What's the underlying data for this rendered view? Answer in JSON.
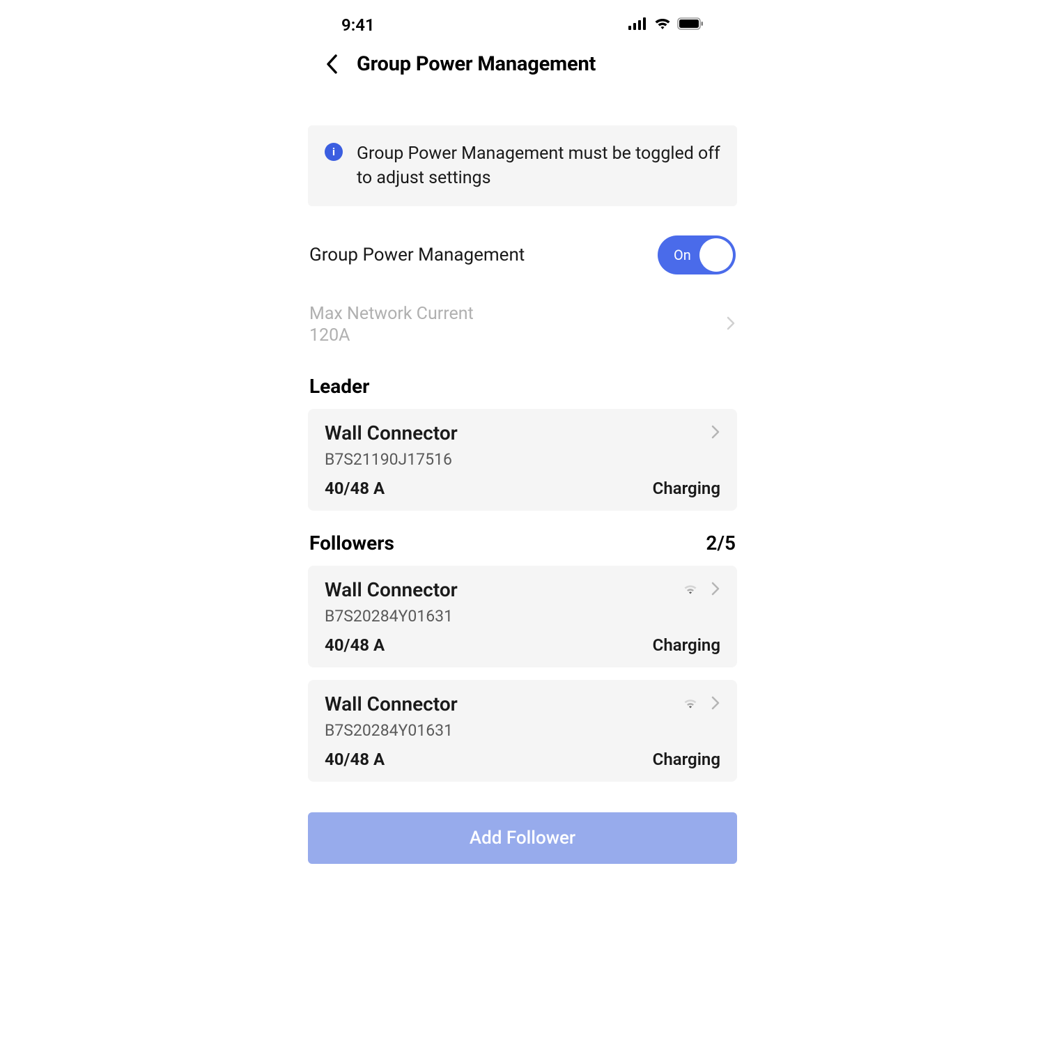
{
  "status_bar": {
    "time": "9:41"
  },
  "header": {
    "title": "Group Power Management"
  },
  "info": {
    "text": "Group Power Management must be toggled off to adjust settings"
  },
  "toggle": {
    "label": "Group Power Management",
    "state_text": "On"
  },
  "max_network": {
    "label": "Max Network Current",
    "value": "120A"
  },
  "leader": {
    "section_title": "Leader",
    "device": {
      "name": "Wall Connector",
      "serial": "B7S21190J17516",
      "amperage": "40/48 A",
      "status": "Charging"
    }
  },
  "followers": {
    "section_title": "Followers",
    "count": "2/5",
    "devices": [
      {
        "name": "Wall Connector",
        "serial": "B7S20284Y01631",
        "amperage": "40/48 A",
        "status": "Charging"
      },
      {
        "name": "Wall Connector",
        "serial": "B7S20284Y01631",
        "amperage": "40/48 A",
        "status": "Charging"
      }
    ]
  },
  "add_button": {
    "label": "Add Follower"
  }
}
